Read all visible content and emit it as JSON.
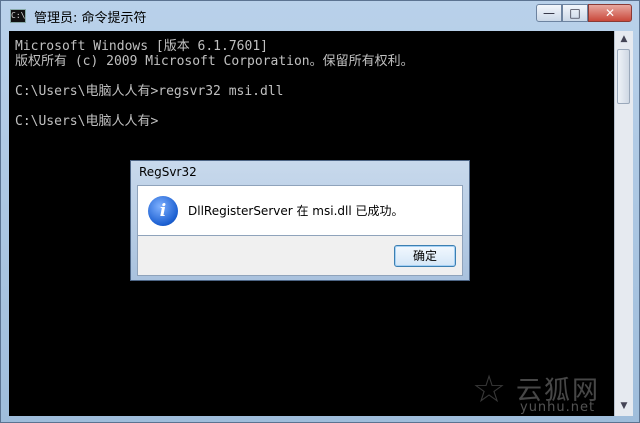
{
  "window": {
    "icon_label": "C:\\",
    "title": "管理员: 命令提示符",
    "controls": {
      "minimize": "—",
      "maximize": "□",
      "close": "✕"
    }
  },
  "console": {
    "lines": [
      "Microsoft Windows [版本 6.1.7601]",
      "版权所有 (c) 2009 Microsoft Corporation。保留所有权利。",
      "",
      "C:\\Users\\电脑人人有>regsvr32 msi.dll",
      "",
      "C:\\Users\\电脑人人有>"
    ]
  },
  "scrollbar": {
    "up": "▲",
    "down": "▼"
  },
  "dialog": {
    "title": "RegSvr32",
    "icon": "i",
    "message": "DllRegisterServer 在 msi.dll 已成功。",
    "ok_label": "确定"
  },
  "watermark": {
    "star": "☆",
    "text": "云狐网",
    "url": "yunhu.net"
  }
}
